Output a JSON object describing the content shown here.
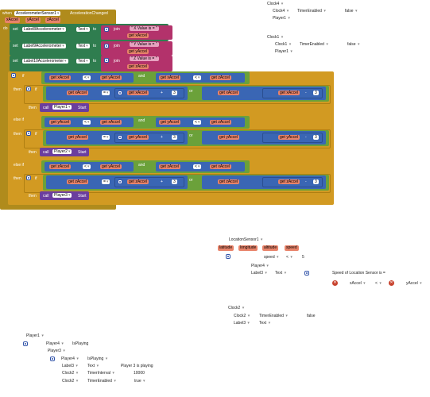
{
  "event": {
    "when": "when",
    "component": "AccelerometerSensor1",
    "event_name": "AccelerationChanged",
    "params": [
      "xAccel",
      "yAccel",
      "zAccel"
    ],
    "do": "do"
  },
  "set_rows": [
    {
      "set": "set",
      "component": "Label8Accelerometer",
      "prop": "Text",
      "to": "to",
      "join": "join",
      "str": "\" X Value is = \"",
      "get": "get xAccel"
    },
    {
      "set": "set",
      "component": "Label9Accelerometer",
      "prop": "Text",
      "to": "to",
      "join": "join",
      "str": "\" Y Value is = \"",
      "get": "get yAccel"
    },
    {
      "set": "set",
      "component": "Label10Accelerometer",
      "prop": "Text",
      "to": "to",
      "join": "join",
      "str": "\" Z Value is = \"",
      "get": "get zAccel"
    }
  ],
  "if_blocks": [
    {
      "kw": "if",
      "a1": "get xAccel",
      "op1": "<",
      "b1": "get yAccel",
      "and": "and",
      "a2": "get xAccel",
      "op2": "<",
      "b2": "get zAccel",
      "then": "then",
      "c1": "get xAccel",
      "eq": "=",
      "d1": "get xAccel",
      "plus": "+",
      "n1": "3",
      "or": "or",
      "c2": "get xAccel",
      "minus": "-",
      "n2": "3",
      "then2": "then",
      "call": "call",
      "player": "Player1",
      "start": "Start"
    },
    {
      "kw": "else if",
      "a1": "get yAccel",
      "op1": "<",
      "b1": "get xAccel",
      "and": "and",
      "a2": "get yAccel",
      "op2": "<",
      "b2": "get zAccel",
      "then": "then",
      "c1": "get yAccel",
      "eq": "=",
      "d1": "get yAccel",
      "plus": "+",
      "n1": "3",
      "or": "or",
      "c2": "get yAccel",
      "minus": "-",
      "n2": "3",
      "then2": "then",
      "call": "call",
      "player": "Player2",
      "start": "Start"
    },
    {
      "kw": "else if",
      "a1": "get zAccel",
      "op1": "<",
      "b1": "get yAccel",
      "and": "and",
      "a2": "get zAccel",
      "op2": "<",
      "b2": "get xAccel",
      "then": "then",
      "c1": "get zAccel",
      "eq": "=",
      "d1": "get zAccel",
      "plus": "+",
      "n1": "3",
      "or": "or",
      "c2": "get zAccel",
      "minus": "-",
      "n2": "3",
      "then2": "then",
      "call": "call",
      "player": "Player3",
      "start": "Start"
    }
  ],
  "top_right": {
    "clock4": "Clock4",
    "clock4_b": "Clock4",
    "timer_enabled": "TimerEnabled",
    "false1": "false",
    "player1": "Player1",
    "clock1": "Clock1",
    "clock1_b": "Clock1",
    "timer_enabled2": "TimerEnabled",
    "false2": "false",
    "player1_b": "Player1"
  },
  "location": {
    "sensor": "LocationSensor1",
    "tags": [
      "latitude",
      "longitude",
      "altitude",
      "speed"
    ],
    "speed": "speed",
    "lt": "<",
    "five": "5",
    "player4": "Player4",
    "label3": "Label3",
    "text": "Text",
    "speed_msg": "Speed of Location Sensor is =",
    "xaccel": "xAccel",
    "lt2": "<",
    "yaccel": "yAccel"
  },
  "clock2": {
    "clock2": "Clock2",
    "clock2_b": "Clock2",
    "timer_enabled": "TimerEnabled",
    "false": "false",
    "label3": "Label3",
    "text": "Text"
  },
  "player_block": {
    "player1": "Player1",
    "player4": "Player4",
    "isplaying": "IsPlaying",
    "player3": "Player3",
    "player4_b": "Player4",
    "isplaying_b": "IsPlaying",
    "label3": "Label3",
    "text": "Text",
    "playing_msg": "Player 3 is playing",
    "clock2": "Clock2",
    "timer_interval": "TimerInterval",
    "interval": "10000",
    "clock2_b": "Clock2",
    "timer_enabled": "TimerEnabled",
    "true": "true"
  },
  "colors": {
    "event": "#b08b1c",
    "set": "#2f7d4f",
    "text": "#b3326b",
    "control": "#d29a22",
    "logic": "#6ba13a",
    "math": "#3a66b4",
    "proc": "#6b3e9e",
    "var": "#e8836a"
  }
}
